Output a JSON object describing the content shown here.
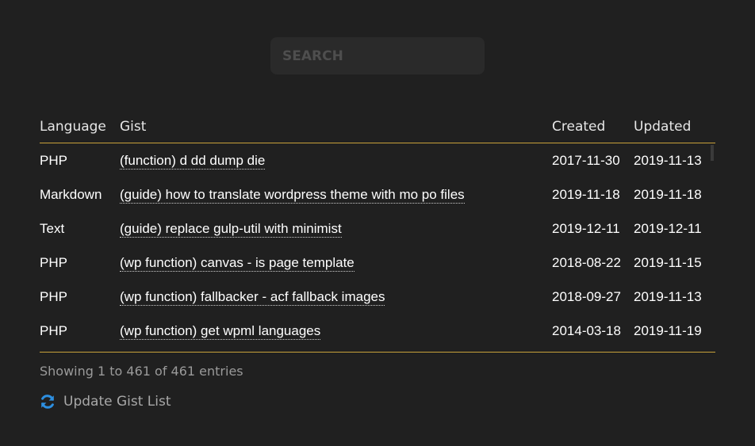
{
  "search": {
    "placeholder": "SEARCH"
  },
  "table": {
    "headers": {
      "language": "Language",
      "gist": "Gist",
      "created": "Created",
      "updated": "Updated"
    },
    "rows": [
      {
        "language": "PHP",
        "gist": "(function) d dd dump die",
        "created": "2017-11-30",
        "updated": "2019-11-13"
      },
      {
        "language": "Markdown",
        "gist": "(guide) how to translate wordpress theme with mo po files",
        "created": "2019-11-18",
        "updated": "2019-11-18"
      },
      {
        "language": "Text",
        "gist": "(guide) replace gulp-util with minimist",
        "created": "2019-12-11",
        "updated": "2019-12-11"
      },
      {
        "language": "PHP",
        "gist": "(wp function) canvas - is page template",
        "created": "2018-08-22",
        "updated": "2019-11-15"
      },
      {
        "language": "PHP",
        "gist": "(wp function) fallbacker - acf fallback images",
        "created": "2018-09-27",
        "updated": "2019-11-13"
      },
      {
        "language": "PHP",
        "gist": "(wp function) get wpml languages",
        "created": "2014-03-18",
        "updated": "2019-11-19"
      }
    ]
  },
  "info": "Showing 1 to 461 of 461 entries",
  "update_button": {
    "label": "Update Gist List",
    "icon": "refresh-icon",
    "icon_color": "#2d8fe0"
  },
  "colors": {
    "background": "#202020",
    "accent": "#c9a13a"
  }
}
